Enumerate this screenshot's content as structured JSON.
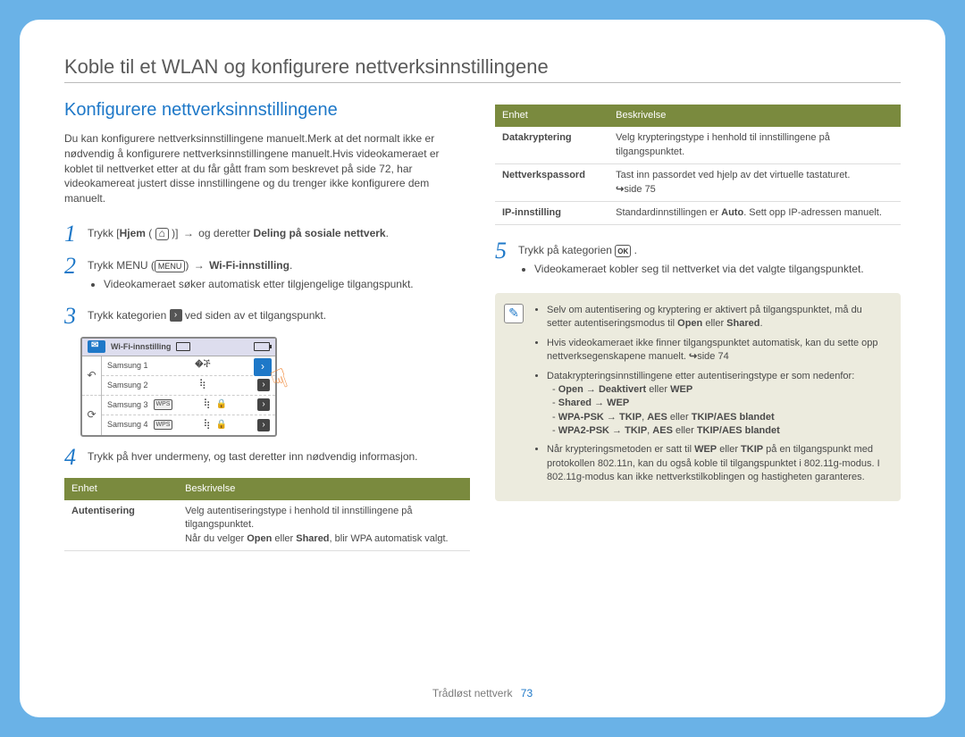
{
  "header": {
    "title": "Koble til et WLAN og konfigurere nettverksinnstillingene"
  },
  "left": {
    "subtitle": "Konfigurere nettverksinnstillingene",
    "intro": "Du kan konfigurere nettverksinnstillingene manuelt.Merk at det normalt ikke er nødvendig å konfigurere nettverksinnstillingene manuelt.Hvis videokameraet er koblet til nettverket etter at du får gått fram som beskrevet på side 72, har videokamereat justert disse innstillingene og du trenger ikke konfigurere dem manuelt.",
    "step1_pre": "Trykk [",
    "step1_home": "Hjem",
    "step1_mid": " ( ",
    "step1_post": " )] ",
    "step1_tail": " og deretter ",
    "step1_bold": "Deling på sosiale nettverk",
    "step2_pre": "Trykk MENU (",
    "step2_menu": "MENU",
    "step2_post": ") ",
    "step2_bold": "Wi-Fi-innstilling",
    "step2_bullet": "Videokameraet søker automatisk etter tilgjengelige tilgangspunkt.",
    "step3_pre": "Trykk kategorien ",
    "step3_post": " ved siden av et tilgangspunkt.",
    "step4": "Trykk på hver undermeny, og tast deretter inn nødvendig informasjon.",
    "table": {
      "h1": "Enhet",
      "h2": "Beskrivelse",
      "r1c1": "Autentisering",
      "r1c2_a": "Velg autentiseringstype i henhold til innstillingene på tilgangspunktet.",
      "r1c2_b_pre": "Når du velger ",
      "r1c2_b_open": "Open",
      "r1c2_b_or": " eller ",
      "r1c2_b_shared": "Shared",
      "r1c2_b_post": ", blir WPA automatisk valgt."
    },
    "screen": {
      "title": "Wi-Fi-innstilling",
      "rows": [
        {
          "name": "Samsung 1",
          "wps": false,
          "lock": false
        },
        {
          "name": "Samsung 2",
          "wps": false,
          "lock": false
        },
        {
          "name": "Samsung 3",
          "wps": true,
          "lock": true
        },
        {
          "name": "Samsung 4",
          "wps": true,
          "lock": true
        }
      ]
    }
  },
  "right": {
    "table": {
      "h1": "Enhet",
      "h2": "Beskrivelse",
      "r1c1": "Datakryptering",
      "r1c2": "Velg krypteringstype i henhold til innstillingene på tilgangspunktet.",
      "r2c1": "Nettverkspassord",
      "r2c2": "Tast inn passordet ved hjelp av det virtuelle tastaturet.",
      "r2c2_ref": "side 75",
      "r3c1": "IP-innstilling",
      "r3c2_pre": "Standardinnstillingen er ",
      "r3c2_auto": "Auto",
      "r3c2_post": ". Sett opp IP-adressen manuelt."
    },
    "step5_pre": "Trykk på kategorien ",
    "ok_label": "OK",
    "step5_dot": " .",
    "step5_bullet": "Videokameraet kobler seg til nettverket via det valgte tilgangspunktet.",
    "note": {
      "b1_pre": "Selv om autentisering og kryptering er aktivert på tilgangspunktet, må du setter autentiseringsmodus til ",
      "b1_open": "Open",
      "b1_or": " eller ",
      "b1_shared": "Shared",
      "b1_post": ".",
      "b2_pre": "Hvis videokameraet ikke finner tilgangspunktet automatisk, kan du sette opp nettverksegenskapene manuelt. ",
      "b2_ref": "side 74",
      "b3": "Datakrypteringsinnstillingene etter autentiseringstype er som nedenfor:",
      "s1_a": "Open",
      "s1_arrow": " → ",
      "s1_b": "Deaktivert",
      "s1_or": " eller ",
      "s1_c": "WEP",
      "s2_a": "Shared",
      "s2_b": "WEP",
      "s3_a": "WPA-PSK",
      "s3_b": "TKIP",
      "s3_c": "AES",
      "s3_d": "TKIP/AES blandet",
      "s4_a": "WPA2-PSK",
      "s4_b": "TKIP",
      "s4_c": "AES",
      "s4_d": "TKIP/AES blandet",
      "b4_pre": "Når krypteringsmetoden er satt til ",
      "b4_wep": "WEP",
      "b4_mid": " eller ",
      "b4_tkip": "TKIP",
      "b4_post": " på en tilgangspunkt med protokollen 802.11n, kan du også koble til tilgangspunktet i 802.11g-modus. I 802.11g-modus kan ikke nettverkstilkoblingen og hastigheten garanteres."
    }
  },
  "footer": {
    "section": "Trådløst nettverk",
    "page": "73"
  }
}
